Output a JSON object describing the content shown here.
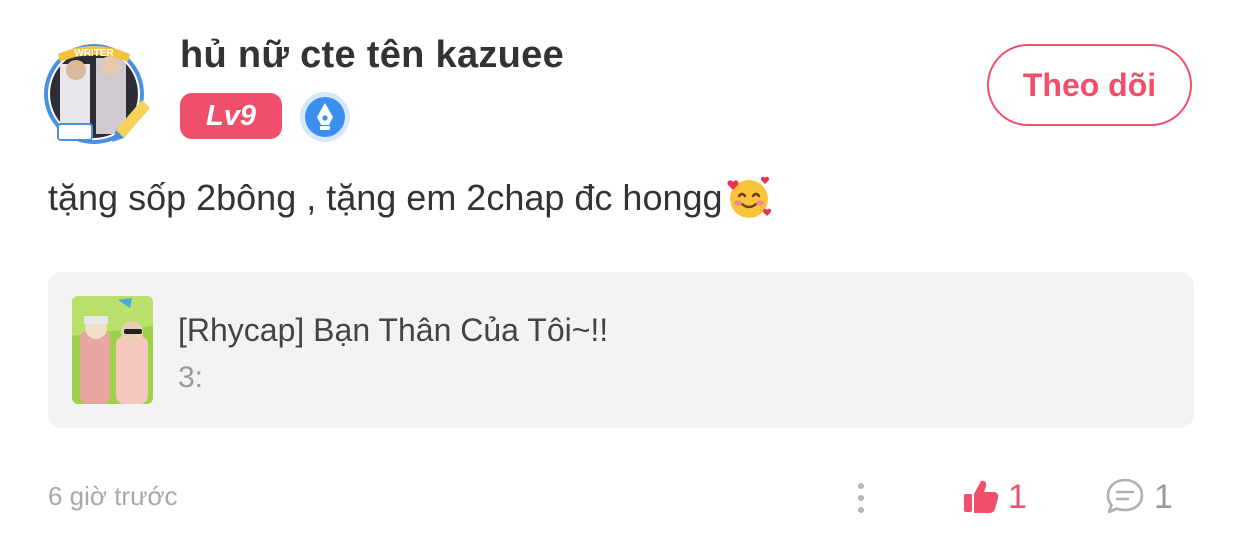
{
  "post": {
    "author": {
      "name": "hủ nữ cte tên kazuee",
      "level": "Lv9",
      "avatar_frame_text": "WRITER",
      "avatar_icon": "writer-avatar-frame",
      "badge_icon": "pen-nib-icon"
    },
    "follow_label": "Theo dõi",
    "content": "tặng sốp 2bông , tặng em 2chap đc hongg",
    "content_emoji": "smiling-face-with-hearts-emoji",
    "linked_story": {
      "title": "[Rhycap] Bạn Thân Của Tôi~!!",
      "subtitle": "3:",
      "thumbnail": "story-cover-image"
    },
    "timestamp": "6 giờ trước",
    "likes": "1",
    "comments": "1"
  },
  "colors": {
    "accent": "#ef4f6a",
    "text_primary": "#333333",
    "text_muted": "#a8a8a8",
    "card_bg": "#f3f3f4",
    "badge_blue": "#3b8ff0"
  }
}
